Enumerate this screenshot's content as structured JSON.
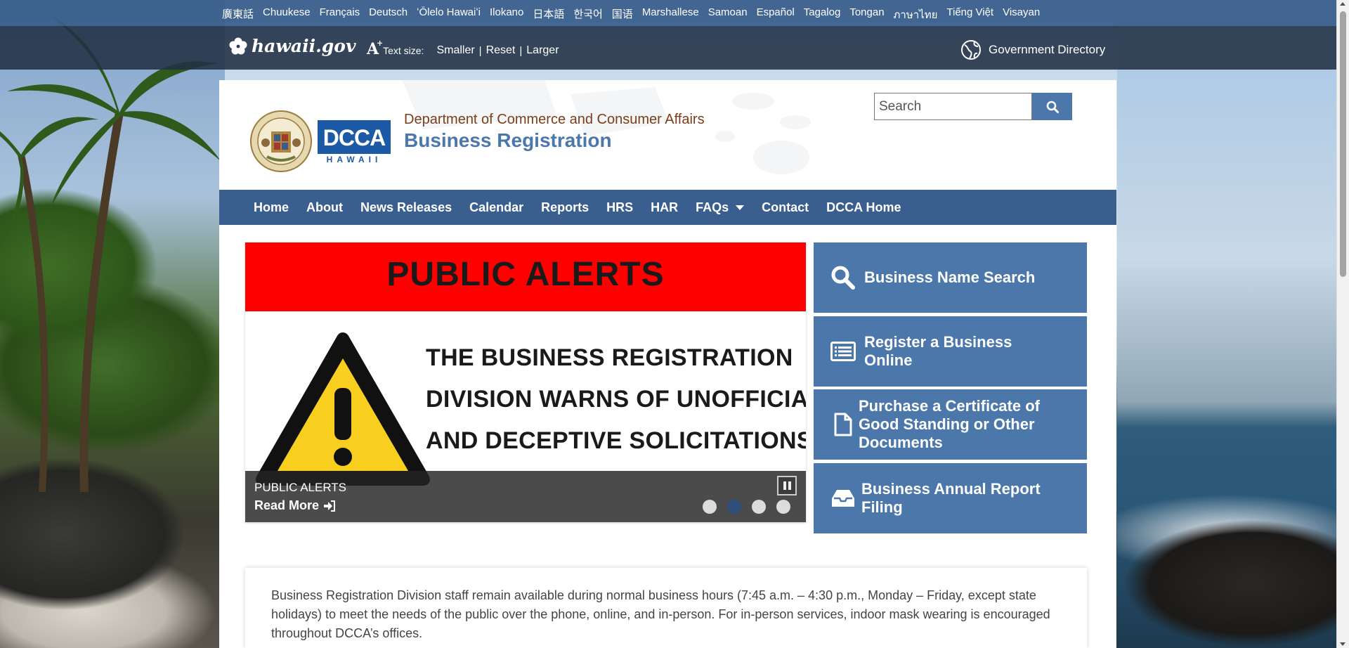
{
  "languages": [
    "廣東話",
    "Chuukese",
    "Français",
    "Deutsch",
    "ʻŌlelo Hawaiʻi",
    "Ilokano",
    "日本語",
    "한국어",
    "国语",
    "Marshallese",
    "Samoan",
    "Español",
    "Tagalog",
    "Tongan",
    "ภาษาไทย",
    "Tiếng Việt",
    "Visayan"
  ],
  "govbar": {
    "logo_text": "hawaii.gov",
    "text_size_label": "Text size:",
    "smaller": "Smaller",
    "reset": "Reset",
    "larger": "Larger",
    "separator": "|",
    "directory": "Government Directory"
  },
  "header": {
    "department": "Department of Commerce and Consumer Affairs",
    "division": "Business Registration",
    "dcca_logo_text": "DCCA",
    "dcca_logo_sub": "HAWAII"
  },
  "search": {
    "placeholder": "Search"
  },
  "nav": {
    "items": [
      "Home",
      "About",
      "News Releases",
      "Calendar",
      "Reports",
      "HRS",
      "HAR",
      "FAQs",
      "Contact",
      "DCCA Home"
    ]
  },
  "slideshow": {
    "banner": "PUBLIC ALERTS",
    "lines": [
      "THE BUSINESS REGISTRATION",
      "DIVISION WARNS OF UNOFFICIAL",
      "AND DECEPTIVE SOLICITATIONS"
    ],
    "caption_title": "PUBLIC ALERTS",
    "read_more": "Read More",
    "slide_count": 4,
    "active_slide": 2
  },
  "quick_links": [
    {
      "label": "Business Name Search",
      "icon": "search-icon"
    },
    {
      "label": "Register a Business Online",
      "icon": "form-icon"
    },
    {
      "label": "Purchase a Certificate of Good Standing or Other Documents",
      "icon": "document-icon"
    },
    {
      "label": "Business Annual Report Filing",
      "icon": "inbox-icon"
    }
  ],
  "notice": "Business Registration Division staff remain available during normal business hours (7:45 a.m. – 4:30 p.m., Monday – Friday, except state holidays) to meet the needs of the public over the phone, online, and in-person. For in-person services, indoor mask wearing is encouraged throughout DCCA’s offices.",
  "colors": {
    "brand_blue": "#4b77aa",
    "nav_blue": "#3a5f8e",
    "alert_red": "#ff0000",
    "dept_brown": "#7a3e1b"
  }
}
